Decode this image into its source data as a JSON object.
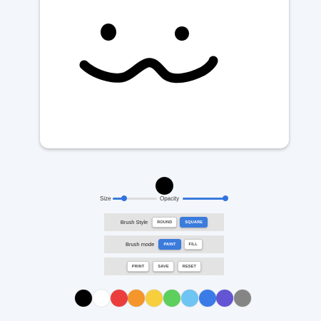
{
  "controls": {
    "size_label": "Size",
    "opacity_label": "Opacity",
    "size_value": 0.25,
    "opacity_value": 1.0
  },
  "brush_style": {
    "label": "Brush Style",
    "options": [
      "ROUND",
      "SQUARE"
    ],
    "selected": "SQUARE"
  },
  "brush_mode": {
    "label": "Brush mode",
    "options": [
      "PAINT",
      "FILL"
    ],
    "selected": "PAINT"
  },
  "actions": {
    "print_label": "PRINT",
    "save_label": "SAVE",
    "reset_label": "RESET"
  },
  "brush_color": "#000000",
  "palette": [
    {
      "name": "black",
      "color": "#000000"
    },
    {
      "name": "white",
      "color": "#ffffff"
    },
    {
      "name": "red",
      "color": "#ec3d3d"
    },
    {
      "name": "orange",
      "color": "#f4962b"
    },
    {
      "name": "yellow",
      "color": "#f7cf3c"
    },
    {
      "name": "green",
      "color": "#5ccf5c"
    },
    {
      "name": "light-blue",
      "color": "#6ec4f2"
    },
    {
      "name": "blue",
      "color": "#3a7be8"
    },
    {
      "name": "purple",
      "color": "#6355d4"
    },
    {
      "name": "gray",
      "color": "#858585"
    }
  ]
}
